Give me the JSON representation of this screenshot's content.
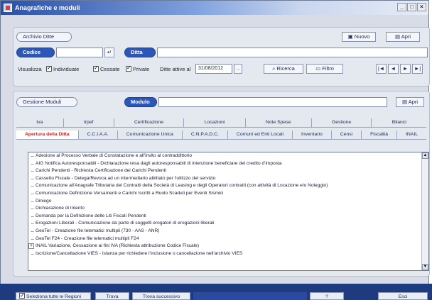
{
  "window": {
    "title": "Anagrafiche e moduli",
    "controls": [
      "_",
      "□",
      "×"
    ]
  },
  "archive": {
    "archive_label": "Archivio Ditte",
    "new_label": "Nuovo",
    "open_label": "Apri",
    "code_label": "Codice",
    "code_value": "",
    "company_label": "Ditta",
    "company_value": "",
    "show_label": "Visualizza",
    "opt_active": "Individuate",
    "opt_ceased": "Cessate",
    "opt_private": "Private",
    "date_label": "Ditte attive al",
    "date_value": "31/08/2012",
    "search_label": "Ricerca",
    "filter_label": "Filtro",
    "nav": [
      "|◄",
      "◄",
      "►",
      "►|"
    ]
  },
  "modules": {
    "manager_label": "Gestione Moduli",
    "module_label": "Modulo",
    "module_value": "",
    "open_label": "Apri",
    "tabs_top": [
      "Iva",
      "Irpef",
      "Certificazione",
      "Locazioni",
      "Note Spese",
      "Gestione",
      "Bilanci"
    ],
    "tabs_bottom": [
      "Apertura della Ditta",
      "C.C.I.A.A.",
      "Comunicazione Unica",
      "C.N.P.A.D.C.",
      "Comuni ed Enti Locali",
      "Inventario",
      "Censi",
      "Fiscalità",
      "INAIL"
    ],
    "list_items": [
      "Adesione al Processo Verbale di Constatazione e all'invito al contraddittorio",
      "AIG Notifica Autoresponsabili - Dichiarazione resa dagli autoresponsabili di intenzione beneficiare del credito d'imposta",
      "Carichi Pendenti - Richiesta Certificazione dei Carichi Pendenti",
      "Cassetto Fiscale - Delega/Revoca ad un intermediario abilitato per l'utilizzo del servizio",
      "Comunicazione all'Anagrafe Tributaria dei Contratti della Società di Leasing e degli Operatori contratti (con attività di Locazione e/o Noleggio)",
      "Comunicazione Definizione Versamenti e Carichi Iscritti a Ruolo Scaduti per Eventi Sismici",
      "Diniego",
      "Dichiarazione di Intento",
      "Domanda per la Definizione delle Liti Fiscali Pendenti",
      "Erogazioni Liberali - Comunicazione da parte di soggetti erogatori di erogazioni liberali",
      "GeoTel - Creazione file telematici multipli (730 - AAS - ANR)",
      "GeoTel F24 - Creazione file telematici multipli F24",
      "INAIL Variazione, Cessazione ai fini IVA (Richiesta attribuzione Codice Fiscale)",
      "Iscrizione/Cancellazione VIES - Istanza per richiedere l'inclusione o cancellazione nell'archivio VIES"
    ]
  },
  "status": {
    "item1": "Seleziona tutte le Regioni",
    "item2": "Trova",
    "item3": "Trova successivo",
    "item4": "?",
    "item5": "Esci"
  }
}
